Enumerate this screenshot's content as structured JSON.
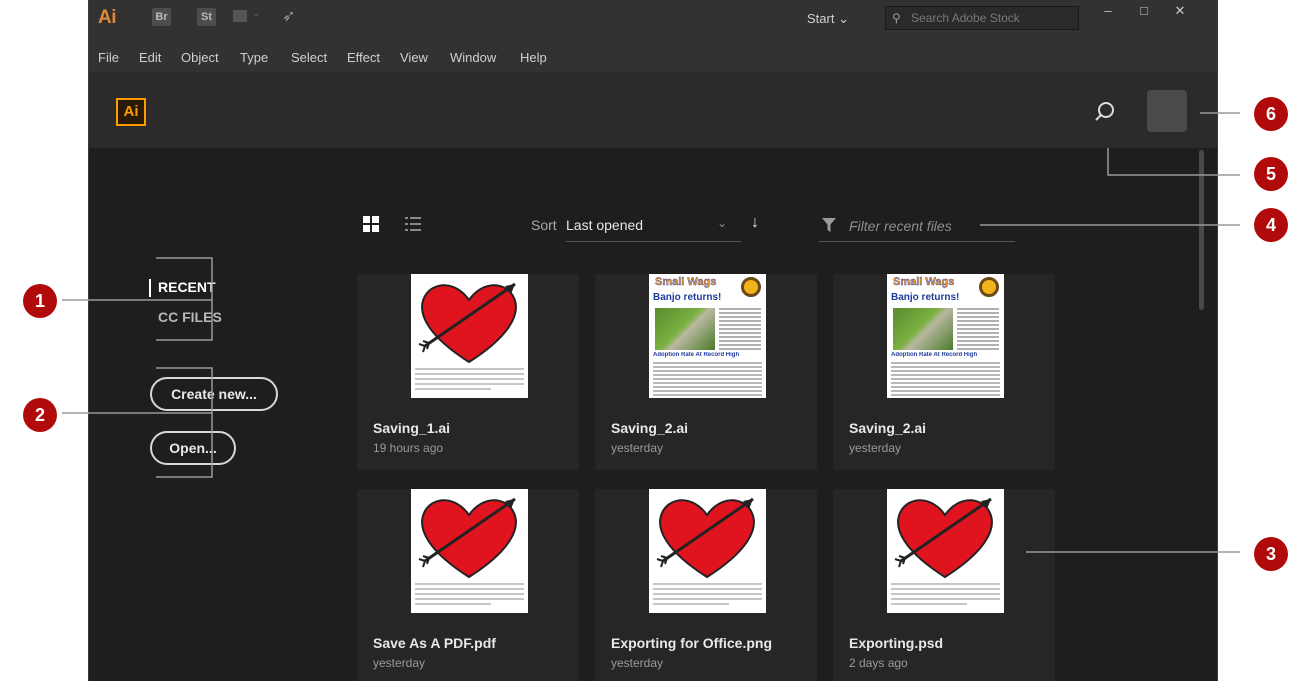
{
  "titlebar": {
    "app_logo": "Ai",
    "bridge_label": "Br",
    "stock_app_label": "St",
    "workspace_label": "Start",
    "stock_search_placeholder": "Search Adobe Stock",
    "window_buttons": [
      "–",
      "□",
      "✕"
    ]
  },
  "menu": [
    "File",
    "Edit",
    "Object",
    "Type",
    "Select",
    "Effect",
    "View",
    "Window",
    "Help"
  ],
  "header": {
    "logo": "Ai"
  },
  "nav": {
    "recent": "RECENT",
    "cc_files": "CC FILES"
  },
  "actions": {
    "create_new": "Create new...",
    "open": "Open..."
  },
  "toolbar": {
    "sort_label": "Sort",
    "sort_value": "Last opened",
    "filter_placeholder": "Filter recent files"
  },
  "files": [
    {
      "name": "Saving_1.ai",
      "time": "19 hours ago",
      "thumb": "heart"
    },
    {
      "name": "Saving_2.ai",
      "time": "yesterday",
      "thumb": "newsletter"
    },
    {
      "name": "Saving_2.ai",
      "time": "yesterday",
      "thumb": "newsletter"
    },
    {
      "name": "Save As A PDF.pdf",
      "time": "yesterday",
      "thumb": "heart"
    },
    {
      "name": "Exporting for Office.png",
      "time": "yesterday",
      "thumb": "heart"
    },
    {
      "name": "Exporting.psd",
      "time": "2 days ago",
      "thumb": "heart"
    }
  ],
  "newsletter": {
    "masthead": "Small Wags",
    "headline": "Banjo returns!",
    "subhead": "Adoption Rate At Record High"
  },
  "callouts": [
    "1",
    "2",
    "3",
    "4",
    "5",
    "6"
  ],
  "colors": {
    "accent": "#ff9a00",
    "callout": "#b00a0a",
    "app_bg": "#1e1e1e"
  }
}
